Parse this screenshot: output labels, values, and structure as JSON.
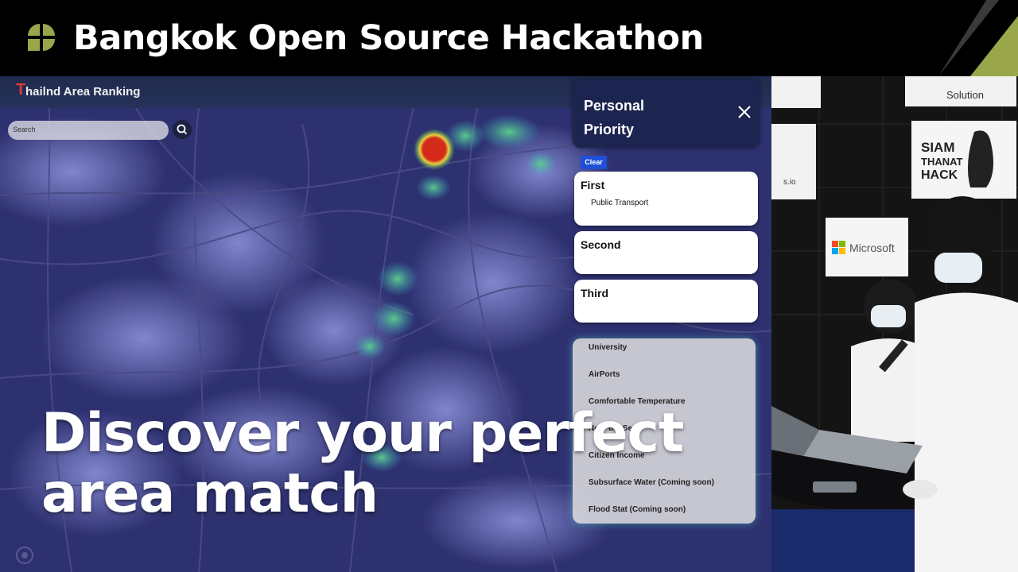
{
  "banner": {
    "title": "Bangkok Open Source Hackathon",
    "logo_icon": "four-leaf-logo-icon",
    "accent_color": "#9aa64a"
  },
  "app": {
    "title": "hailnd Area Ranking",
    "logo_letter": "T",
    "search": {
      "placeholder": "Search"
    },
    "personal_priority": {
      "title_line1": "Personal",
      "title_line2": "Priority",
      "clear_label": "Clear",
      "slots": [
        {
          "label": "First",
          "value": "Public Transport"
        },
        {
          "label": "Second",
          "value": ""
        },
        {
          "label": "Third",
          "value": ""
        }
      ],
      "options": [
        "University",
        "AirPorts",
        "Comfortable Temperature",
        "Near the Sea",
        "Citizen Income",
        "Subsurface Water (Coming soon)",
        "Flood Stat (Coming soon)"
      ]
    }
  },
  "caption": {
    "line1": "Discover your perfect",
    "line2": "area match"
  },
  "camera": {
    "signs": [
      "Solution",
      "SIAM THANAT HACK",
      "Microsoft",
      "s.io"
    ]
  }
}
